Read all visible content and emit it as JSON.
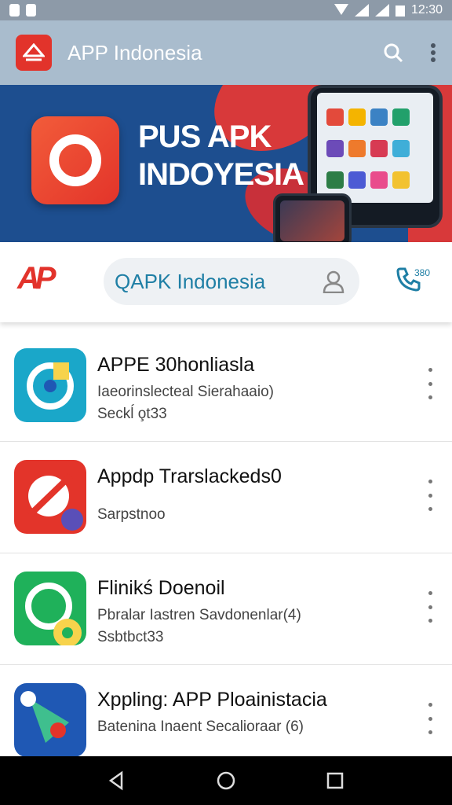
{
  "status_bar": {
    "time": "12:30"
  },
  "toolbar": {
    "title": "APP Indonesia",
    "logo_icon": "app-logo-icon",
    "search_icon": "search-icon",
    "menu_icon": "more-vert-icon"
  },
  "banner": {
    "line1": "PUS APK",
    "line2": "INDOYESIA"
  },
  "search": {
    "logo_text": "AP",
    "query": "QAPK Indonesia",
    "phone_number": "380"
  },
  "apps": [
    {
      "name": "APPE 30honliasla",
      "desc": "Iaeorinslecteal Sierahaaio)",
      "meta": "Seckĺ o̧t33",
      "color": "#1aa7c9"
    },
    {
      "name": "Appdp Trarslackeds0",
      "desc": "Sarpstnoo",
      "meta": "",
      "color": "#e3342a"
    },
    {
      "name": "Flinikś Doenoil",
      "desc": "Pbralar Iastren Savdonenlar(4)",
      "meta": "Ssbtbct33",
      "color": "#1fb15a"
    },
    {
      "name": "Xppling: APP Ploainistacia",
      "desc": "Batenina Inaent Secalioraar (6)",
      "meta": "",
      "color": "#1f58b4"
    }
  ],
  "colors": {
    "accent": "#e2332b",
    "toolbar": "#a9bccd",
    "banner": "#1d4e8f"
  }
}
